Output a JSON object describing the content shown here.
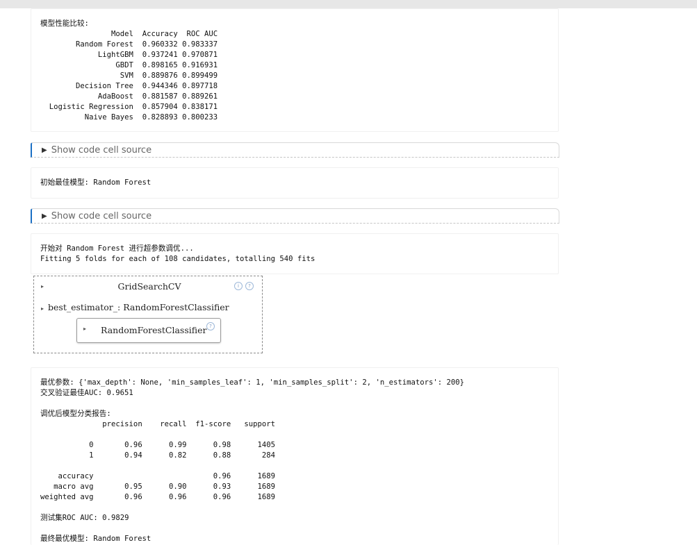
{
  "comparison": {
    "title": "模型性能比较:",
    "header": "                Model  Accuracy  ROC AUC",
    "rows": [
      "        Random Forest  0.960332 0.983337",
      "             LightGBM  0.937241 0.970871",
      "                 GBDT  0.898165 0.916931",
      "                  SVM  0.889876 0.899499",
      "        Decision Tree  0.944346 0.897718",
      "             AdaBoost  0.881587 0.889261",
      "  Logistic Regression  0.857904 0.838171",
      "          Naive Bayes  0.828893 0.800233"
    ]
  },
  "toggles": {
    "show_code_label": "Show code cell source",
    "triangle": "▶"
  },
  "initial_best": "初始最佳模型: Random Forest",
  "tuning": {
    "line1": "开始对 Random Forest 进行超参数调优...",
    "line2": "Fitting 5 folds for each of 108 candidates, totalling 540 fits"
  },
  "estimator": {
    "outer_name": "GridSearchCV",
    "best_label": "best_estimator_: RandomForestClassifier",
    "inner_name": "RandomForestClassifier",
    "arrow": "▸",
    "info_icon": "i",
    "help_icon": "?"
  },
  "results": {
    "best_params": "最优参数: {'max_depth': None, 'min_samples_leaf': 1, 'min_samples_split': 2, 'n_estimators': 200}",
    "cv_auc": "交叉验证最佳AUC: 0.9651",
    "report_title": "调优后模型分类报告:",
    "report_lines": [
      "              precision    recall  f1-score   support",
      "",
      "           0       0.96      0.99      0.98      1405",
      "           1       0.94      0.82      0.88       284",
      "",
      "    accuracy                           0.96      1689",
      "   macro avg       0.95      0.90      0.93      1689",
      "weighted avg       0.96      0.96      0.96      1689"
    ],
    "test_auc": "测试集ROC AUC: 0.9829",
    "final_best": "最终最优模型: Random Forest"
  }
}
